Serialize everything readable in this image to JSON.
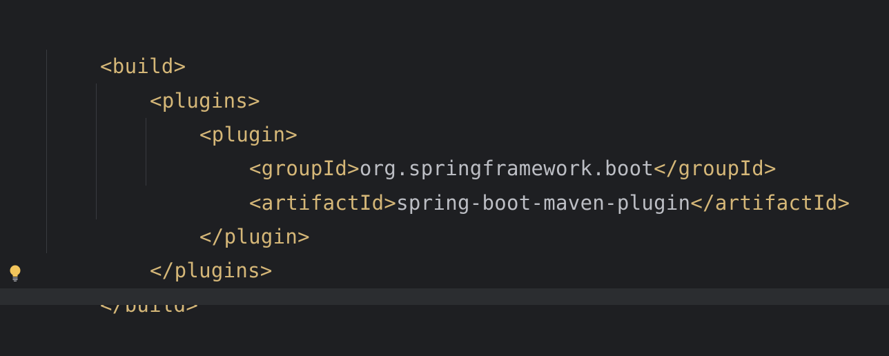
{
  "editor": {
    "lines": [
      {
        "indent": 0,
        "open": "<build>",
        "text": "",
        "close": ""
      },
      {
        "indent": 1,
        "open": "<plugins>",
        "text": "",
        "close": ""
      },
      {
        "indent": 2,
        "open": "<plugin>",
        "text": "",
        "close": ""
      },
      {
        "indent": 3,
        "open": "<groupId>",
        "text": "org.springframework.boot",
        "close": "</groupId>"
      },
      {
        "indent": 3,
        "open": "<artifactId>",
        "text": "spring-boot-maven-plugin",
        "close": "</artifactId>"
      },
      {
        "indent": 2,
        "open": "</plugin>",
        "text": "",
        "close": ""
      },
      {
        "indent": 1,
        "open": "</plugins>",
        "text": "",
        "close": ""
      },
      {
        "indent": 0,
        "open": "</build>",
        "text": "",
        "close": ""
      }
    ]
  },
  "gutter": {
    "intention_icon": "lightbulb-icon"
  },
  "colors": {
    "background": "#1e1f22",
    "tag": "#d5b778",
    "text": "#bcbec4",
    "indent_guide": "#393b40",
    "bulb": "#f2c55c"
  }
}
